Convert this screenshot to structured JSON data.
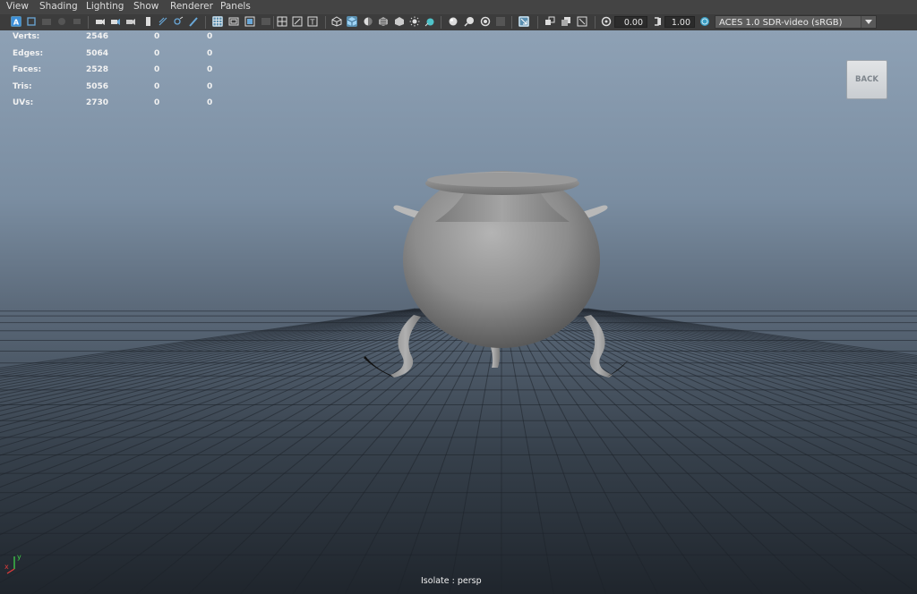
{
  "menu": {
    "items": [
      "View",
      "Shading",
      "Lighting",
      "Show",
      "Renderer",
      "Panels"
    ]
  },
  "toolbar": {
    "icons": [
      "camera-attributes-icon",
      "bookmark-icon",
      "image-plane-icon",
      "2d-pan-zoom-icon",
      "grease-pencil-icon",
      "camera-lock-icon",
      "snapshot-icon",
      "select-camera-icon",
      "film-gate-icon",
      "grid-icon",
      "resolution-gate-icon",
      "gate-mask-icon",
      "field-chart-icon",
      "safe-action-icon",
      "safe-title-icon",
      "wireframe-icon",
      "smooth-shade-icon",
      "wireframe-on-shaded-icon",
      "textured-icon",
      "use-lights-icon",
      "shadows-icon",
      "ambient-occlusion-icon",
      "motion-blur-icon",
      "anti-aliasing-icon",
      "depth-of-field-icon",
      "isolate-select-icon",
      "xray-icon",
      "xray-joints-icon",
      "backface-culling-icon",
      "exposure-icon",
      "gamma-icon",
      "color-management-icon"
    ],
    "exposure_value": "0.00",
    "gamma_value": "1.00",
    "color_space": "ACES 1.0 SDR-video (sRGB)"
  },
  "hud": {
    "rows": [
      {
        "label": "Verts:",
        "v1": "2546",
        "v2": "0",
        "v3": "0"
      },
      {
        "label": "Edges:",
        "v1": "5064",
        "v2": "0",
        "v3": "0"
      },
      {
        "label": "Faces:",
        "v1": "2528",
        "v2": "0",
        "v3": "0"
      },
      {
        "label": "Tris:",
        "v1": "5056",
        "v2": "0",
        "v3": "0"
      },
      {
        "label": "UVs:",
        "v1": "2730",
        "v2": "0",
        "v3": "0"
      }
    ]
  },
  "viewcube": {
    "label": "BACK"
  },
  "status": {
    "isolate_label": "Isolate : persp"
  },
  "axis": {
    "y_label": "y",
    "x_label": "x"
  },
  "colors": {
    "accent": "#5a8fb0",
    "toolbar_bg": "#3c3c3c",
    "menubar_bg": "#444444"
  }
}
